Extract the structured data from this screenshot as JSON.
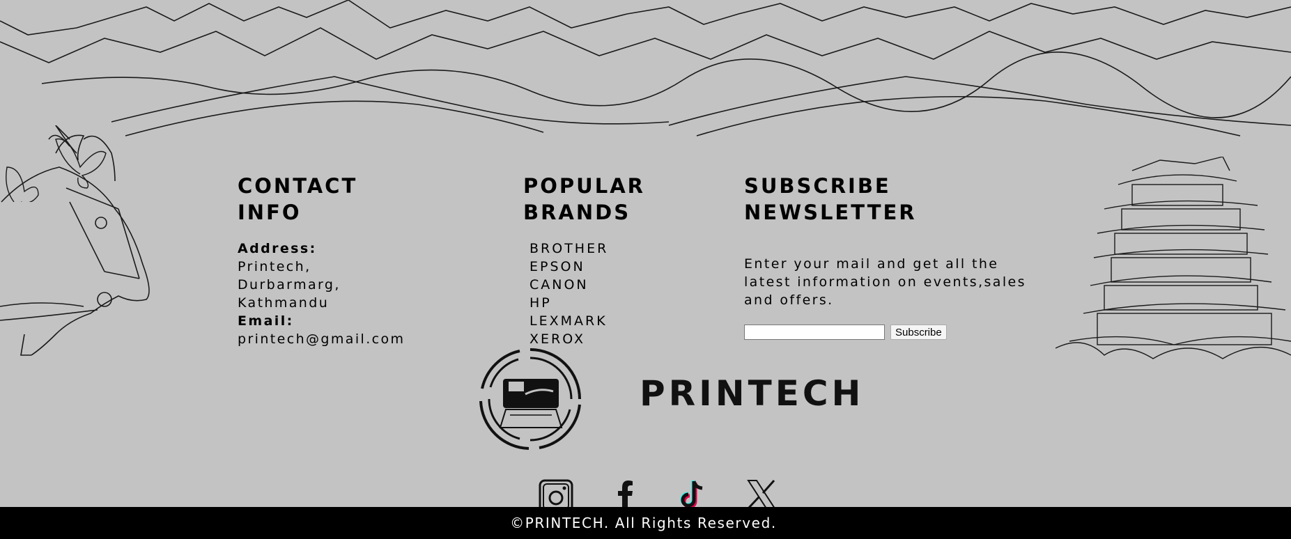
{
  "contact": {
    "heading_line1": "CONTACT",
    "heading_line2": "INFO",
    "address_label": "Address:",
    "address_lines": [
      "Printech,",
      "Durbarmarg,",
      "Kathmandu"
    ],
    "email_label": "Email:",
    "email": "printech@gmail.com"
  },
  "brands": {
    "heading_line1": "POPULAR",
    "heading_line2": "BRANDS",
    "items": [
      "BROTHER",
      "EPSON",
      "CANON",
      "HP",
      "LEXMARK",
      "XEROX"
    ]
  },
  "newsletter": {
    "heading": "SUBSCRIBE NEWSLETTER",
    "description": "Enter your mail and get all the latest information on events,sales and offers.",
    "email_value": "",
    "button_label": "Subscribe"
  },
  "logo": {
    "text": "PRINTECH"
  },
  "social": {
    "icons": [
      "instagram-icon",
      "facebook-icon",
      "tiktok-icon",
      "x-icon"
    ]
  },
  "footer": {
    "copyright": "©PRINTECH. All Rights Reserved."
  },
  "colors": {
    "background": "#c3c3c3",
    "footer_bar": "#000000",
    "text": "#000000",
    "footer_text": "#ffffff"
  }
}
